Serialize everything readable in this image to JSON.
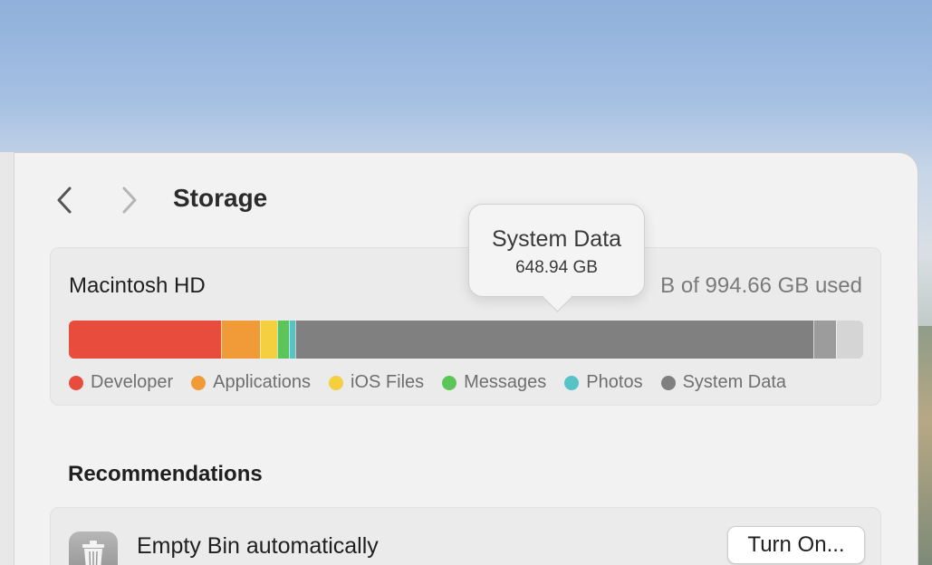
{
  "window": {
    "title": "Storage"
  },
  "storage": {
    "disk_name": "Macintosh HD",
    "used_text": "B of 994.66 GB used",
    "bar_segments": [
      {
        "category": "Developer",
        "fraction": 0.191,
        "color": "#e84c3d"
      },
      {
        "category": "Applications",
        "fraction": 0.05,
        "color": "#f09a38"
      },
      {
        "category": "iOS Files",
        "fraction": 0.021,
        "color": "#f4cf40"
      },
      {
        "category": "Messages",
        "fraction": 0.015,
        "color": "#5cc55a"
      },
      {
        "category": "Photos",
        "fraction": 0.008,
        "color": "#58c3c6"
      },
      {
        "category": "System Data",
        "fraction": 0.652,
        "color": "#808080"
      },
      {
        "category": "Other",
        "fraction": 0.029,
        "color": "#9c9c9c"
      },
      {
        "category": "Free",
        "fraction": 0.034,
        "color": "#d5d5d5"
      }
    ],
    "legend": [
      {
        "label": "Developer",
        "color": "#e84c3d"
      },
      {
        "label": "Applications",
        "color": "#f09a38"
      },
      {
        "label": "iOS Files",
        "color": "#f4cf40"
      },
      {
        "label": "Messages",
        "color": "#5cc55a"
      },
      {
        "label": "Photos",
        "color": "#58c3c6"
      },
      {
        "label": "System Data",
        "color": "#808080"
      }
    ]
  },
  "tooltip": {
    "title": "System Data",
    "value": "648.94 GB"
  },
  "recommendations": {
    "heading": "Recommendations",
    "items": [
      {
        "title": "Empty Bin automatically",
        "button_label": "Turn On...",
        "icon": "trash-icon"
      }
    ]
  }
}
